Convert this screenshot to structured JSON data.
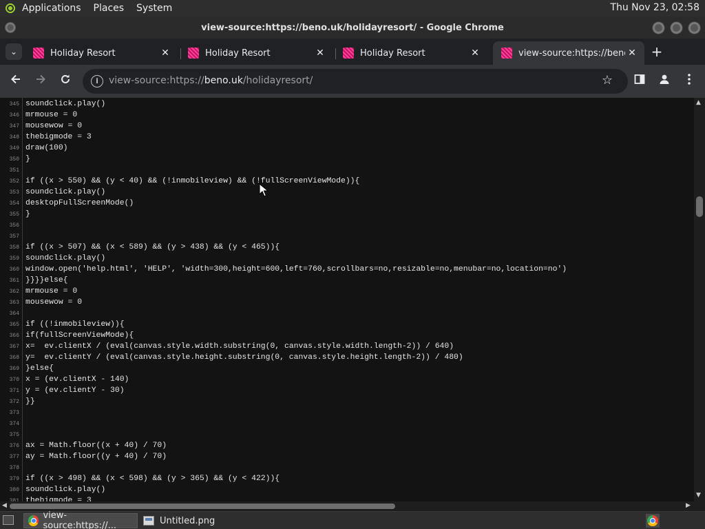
{
  "top_panel": {
    "menus": [
      "Applications",
      "Places",
      "System"
    ],
    "clock": "Thu Nov 23, 02:58"
  },
  "window": {
    "title": "view-source:https://beno.uk/holidayresort/ - Google Chrome"
  },
  "tabs": [
    {
      "title": "Holiday Resort",
      "active": false
    },
    {
      "title": "Holiday Resort",
      "active": false
    },
    {
      "title": "Holiday Resort",
      "active": false
    },
    {
      "title": "view-source:https://beno.uk",
      "active": true
    }
  ],
  "toolbar": {
    "url_prefix": "view-source:https://",
    "url_host": "beno.uk",
    "url_path": "/holidayresort/"
  },
  "source_lines": [
    {
      "n": "345",
      "code": "soundclick.play()"
    },
    {
      "n": "346",
      "code": "mrmouse = 0"
    },
    {
      "n": "347",
      "code": "mousewow = 0"
    },
    {
      "n": "348",
      "code": "thebigmode = 3"
    },
    {
      "n": "349",
      "code": "draw(100)"
    },
    {
      "n": "350",
      "code": "}"
    },
    {
      "n": "351",
      "code": ""
    },
    {
      "n": "352",
      "code": "if ((x > 550) && (y < 40) && (!inmobileview) && (!fullScreenViewMode)){"
    },
    {
      "n": "353",
      "code": "soundclick.play()"
    },
    {
      "n": "354",
      "code": "desktopFullScreenMode()"
    },
    {
      "n": "355",
      "code": "}"
    },
    {
      "n": "356",
      "code": ""
    },
    {
      "n": "357",
      "code": ""
    },
    {
      "n": "358",
      "code": "if ((x > 507) && (x < 589) && (y > 438) && (y < 465)){"
    },
    {
      "n": "359",
      "code": "soundclick.play()"
    },
    {
      "n": "360",
      "code": "window.open('help.html', 'HELP', 'width=300,height=600,left=760,scrollbars=no,resizable=no,menubar=no,location=no')"
    },
    {
      "n": "361",
      "code": "}}}}else{"
    },
    {
      "n": "362",
      "code": "mrmouse = 0"
    },
    {
      "n": "363",
      "code": "mousewow = 0"
    },
    {
      "n": "364",
      "code": ""
    },
    {
      "n": "365",
      "code": "if ((!inmobileview)){"
    },
    {
      "n": "366",
      "code": "if(fullScreenViewMode){"
    },
    {
      "n": "367",
      "code": "x=  ev.clientX / (eval(canvas.style.width.substring(0, canvas.style.width.length-2)) / 640)"
    },
    {
      "n": "368",
      "code": "y=  ev.clientY / (eval(canvas.style.height.substring(0, canvas.style.height.length-2)) / 480)"
    },
    {
      "n": "369",
      "code": "}else{"
    },
    {
      "n": "370",
      "code": "x = (ev.clientX - 140)"
    },
    {
      "n": "371",
      "code": "y = (ev.clientY - 30)"
    },
    {
      "n": "372",
      "code": "}}"
    },
    {
      "n": "373",
      "code": ""
    },
    {
      "n": "374",
      "code": ""
    },
    {
      "n": "375",
      "code": ""
    },
    {
      "n": "376",
      "code": "ax = Math.floor((x + 40) / 70)"
    },
    {
      "n": "377",
      "code": "ay = Math.floor((y + 40) / 70)"
    },
    {
      "n": "378",
      "code": ""
    },
    {
      "n": "379",
      "code": "if ((x > 498) && (x < 598) && (y > 365) && (y < 422)){"
    },
    {
      "n": "380",
      "code": "soundclick.play()"
    },
    {
      "n": "381",
      "code": "thebigmode = 3"
    }
  ],
  "taskbar": {
    "items": [
      {
        "label": "view-source:https://...",
        "active": true
      },
      {
        "label": "Untitled.png",
        "active": false
      }
    ]
  }
}
